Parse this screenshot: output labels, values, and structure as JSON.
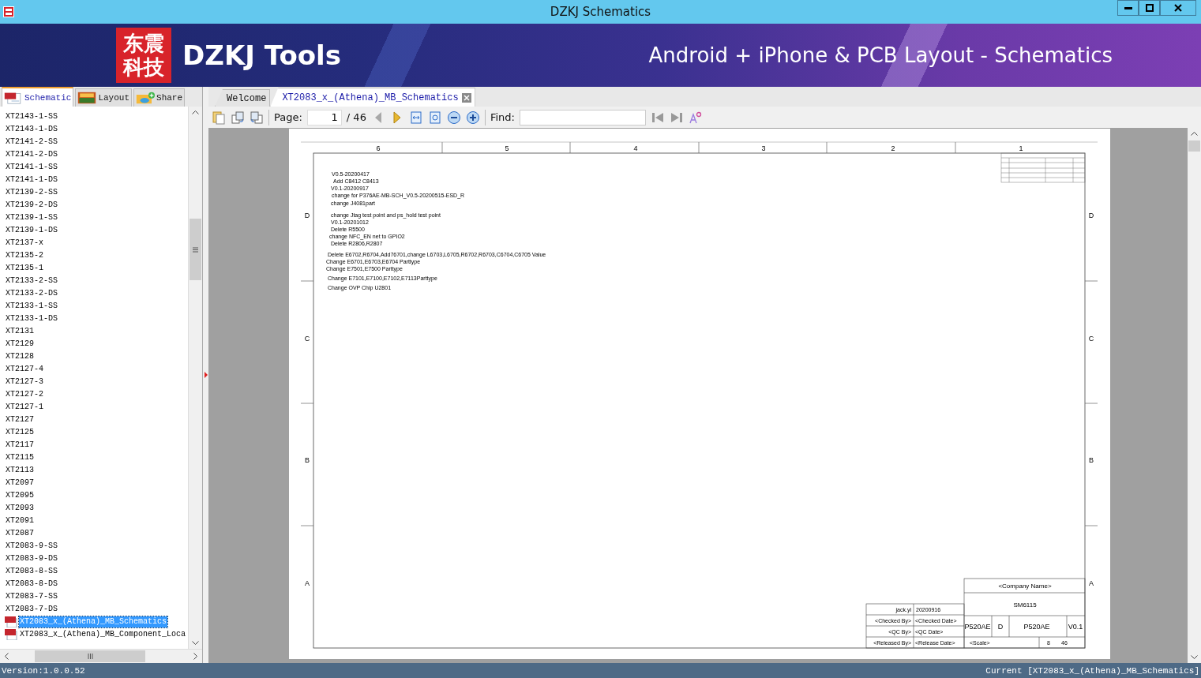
{
  "window": {
    "title": "DZKJ Schematics"
  },
  "banner": {
    "logo_chars": [
      "东震",
      "科技"
    ],
    "name": "DZKJ Tools",
    "tagline": "Android + iPhone & PCB Layout - Schematics"
  },
  "side_tabs": [
    {
      "label": "Schematic",
      "kind": "pdf",
      "selected": true
    },
    {
      "label": "Layout",
      "kind": "pads",
      "selected": false
    },
    {
      "label": "Share",
      "kind": "share",
      "selected": false
    }
  ],
  "tree_items": [
    {
      "label": "XT2143-1-SS",
      "kind": "folder",
      "selected": false
    },
    {
      "label": "XT2143-1-DS",
      "kind": "folder",
      "selected": false
    },
    {
      "label": "XT2141-2-SS",
      "kind": "folder",
      "selected": false
    },
    {
      "label": "XT2141-2-DS",
      "kind": "folder",
      "selected": false
    },
    {
      "label": "XT2141-1-SS",
      "kind": "folder",
      "selected": false
    },
    {
      "label": "XT2141-1-DS",
      "kind": "folder",
      "selected": false
    },
    {
      "label": "XT2139-2-SS",
      "kind": "folder",
      "selected": false
    },
    {
      "label": "XT2139-2-DS",
      "kind": "folder",
      "selected": false
    },
    {
      "label": "XT2139-1-SS",
      "kind": "folder",
      "selected": false
    },
    {
      "label": "XT2139-1-DS",
      "kind": "folder",
      "selected": false
    },
    {
      "label": "XT2137-x",
      "kind": "folder",
      "selected": false
    },
    {
      "label": "XT2135-2",
      "kind": "folder",
      "selected": false
    },
    {
      "label": "XT2135-1",
      "kind": "folder",
      "selected": false
    },
    {
      "label": "XT2133-2-SS",
      "kind": "folder",
      "selected": false
    },
    {
      "label": "XT2133-2-DS",
      "kind": "folder",
      "selected": false
    },
    {
      "label": "XT2133-1-SS",
      "kind": "folder",
      "selected": false
    },
    {
      "label": "XT2133-1-DS",
      "kind": "folder",
      "selected": false
    },
    {
      "label": "XT2131",
      "kind": "folder",
      "selected": false
    },
    {
      "label": "XT2129",
      "kind": "folder",
      "selected": false
    },
    {
      "label": "XT2128",
      "kind": "folder",
      "selected": false
    },
    {
      "label": "XT2127-4",
      "kind": "folder",
      "selected": false
    },
    {
      "label": "XT2127-3",
      "kind": "folder",
      "selected": false
    },
    {
      "label": "XT2127-2",
      "kind": "folder",
      "selected": false
    },
    {
      "label": "XT2127-1",
      "kind": "folder",
      "selected": false
    },
    {
      "label": "XT2127",
      "kind": "folder",
      "selected": false
    },
    {
      "label": "XT2125",
      "kind": "folder",
      "selected": false
    },
    {
      "label": "XT2117",
      "kind": "folder",
      "selected": false
    },
    {
      "label": "XT2115",
      "kind": "folder",
      "selected": false
    },
    {
      "label": "XT2113",
      "kind": "folder",
      "selected": false
    },
    {
      "label": "XT2097",
      "kind": "folder",
      "selected": false
    },
    {
      "label": "XT2095",
      "kind": "folder",
      "selected": false
    },
    {
      "label": "XT2093",
      "kind": "folder",
      "selected": false
    },
    {
      "label": "XT2091",
      "kind": "folder",
      "selected": false
    },
    {
      "label": "XT2087",
      "kind": "folder",
      "selected": false
    },
    {
      "label": "XT2083-9-SS",
      "kind": "folder",
      "selected": false
    },
    {
      "label": "XT2083-9-DS",
      "kind": "folder",
      "selected": false
    },
    {
      "label": "XT2083-8-SS",
      "kind": "folder",
      "selected": false
    },
    {
      "label": "XT2083-8-DS",
      "kind": "folder",
      "selected": false
    },
    {
      "label": "XT2083-7-SS",
      "kind": "folder",
      "selected": false
    },
    {
      "label": "XT2083-7-DS",
      "kind": "folder",
      "selected": false
    },
    {
      "label": "XT2083_x_(Athena)_MB_Schematics",
      "kind": "pdf",
      "selected": true
    },
    {
      "label": "XT2083_x_(Athena)_MB_Component_Loca",
      "kind": "pdf",
      "selected": false
    }
  ],
  "doc_tabs": [
    {
      "label": "Welcome",
      "closable": false,
      "selected": false
    },
    {
      "label": "XT2083_x_(Athena)_MB_Schematics",
      "closable": true,
      "selected": true
    }
  ],
  "toolbar": {
    "page_label": "Page:",
    "page": "1",
    "total": "/ 46",
    "find_label": "Find:"
  },
  "schematic": {
    "columns": [
      "6",
      "5",
      "4",
      "3",
      "2",
      "1"
    ],
    "rows_left": [
      "D",
      "C",
      "B",
      "A"
    ],
    "rows_right": [
      "D",
      "C",
      "B",
      "A"
    ],
    "notes": [
      "V0.5-20200417",
      "Add C8412 C8413",
      "V0.1-20200917",
      "change for P376AE-MB-SCH_V0.5-20200515-ESD_R",
      "change J4081part",
      "change Jtag test point and ps_hold test point",
      "V0.1-20201012",
      "Delete R5500",
      "change NFC_EN net to GPIO2",
      "Delete R2806,R2807",
      "Delete E6702,R6704,Add76701,change L6703,L6705,R6702,R6703,C6704,C6705 Value",
      "Change E6701,E6703,E6704 Parttype",
      "Change E7501,E7500 Parttype",
      "Change E7101,E7100,E7102,E7113Parttype",
      "Change OVP Chip U2801"
    ],
    "title_block": {
      "company": "<Company Name>",
      "title": "SM6115",
      "code": "P520AE",
      "size": "D",
      "drawing_no": "P520AE",
      "rev": "V0.1",
      "drawn_by": "jack.yi",
      "date": "20200916",
      "checked_by": "<Checked By>",
      "checked_date": "<Checked Date>",
      "qc_by": "<QC By>",
      "qc_date": "<QC Date>",
      "released_by": "<Released By>",
      "release_date": "<Release Date>",
      "scale": "<Scale>",
      "sheet": "8",
      "sheets": "46"
    }
  },
  "status_bar": {
    "version": "Version:1.0.0.52",
    "current": "Current [XT2083_x_(Athena)_MB_Schematics]"
  }
}
